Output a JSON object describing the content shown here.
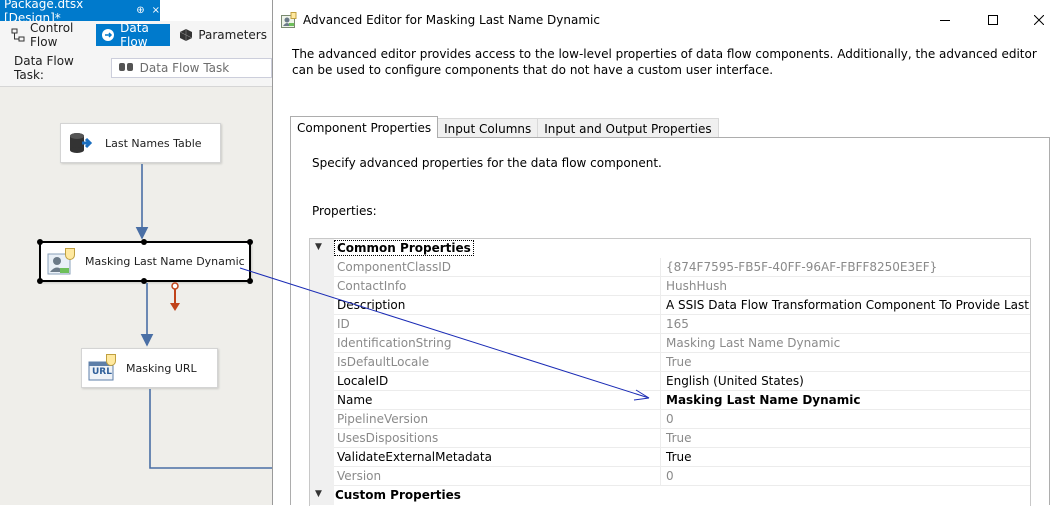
{
  "document_tab": {
    "title": "Package.dtsx [Design]*",
    "pin": "⊕",
    "close": "×"
  },
  "designer": {
    "tabs": [
      {
        "label": "Control Flow"
      },
      {
        "label": "Data Flow"
      },
      {
        "label": "Parameters"
      }
    ],
    "task_label": "Data Flow Task:",
    "task_value": "Data Flow Task",
    "nodes": {
      "source": "Last Names Table",
      "masking": "Masking Last Name Dynamic",
      "url": "Masking URL"
    },
    "url_icon_text": "URL"
  },
  "dialog": {
    "title": "Advanced Editor for Masking Last Name Dynamic",
    "description": "The advanced editor provides access to the low-level properties of data flow components. Additionally, the advanced editor can be used to configure components that do not have a custom user interface.",
    "tabs": [
      {
        "label": "Component Properties"
      },
      {
        "label": "Input Columns"
      },
      {
        "label": "Input and Output Properties"
      }
    ],
    "tab_description": "Specify advanced properties for the data flow component.",
    "properties_label": "Properties:",
    "categories": {
      "common": "Common Properties",
      "custom": "Custom Properties"
    },
    "rows": [
      {
        "name": "ComponentClassID",
        "value": "{874F7595-FB5F-40FF-96AF-FBFF8250E3EF}"
      },
      {
        "name": "ContactInfo",
        "value": "HushHush"
      },
      {
        "name": "Description",
        "value": "A SSIS Data Flow Transformation Component To Provide Last Name D"
      },
      {
        "name": "ID",
        "value": "165"
      },
      {
        "name": "IdentificationString",
        "value": "Masking Last Name Dynamic"
      },
      {
        "name": "IsDefaultLocale",
        "value": "True"
      },
      {
        "name": "LocaleID",
        "value": "English (United States)"
      },
      {
        "name": "Name",
        "value": "Masking Last Name Dynamic"
      },
      {
        "name": "PipelineVersion",
        "value": "0"
      },
      {
        "name": "UsesDispositions",
        "value": "True"
      },
      {
        "name": "ValidateExternalMetadata",
        "value": "True"
      },
      {
        "name": "Version",
        "value": "0"
      }
    ]
  },
  "colors": {
    "accent": "#007acc",
    "connector": "#4a6fa5",
    "error_path": "#c0431a",
    "annotation_arrow": "#1a2bb5"
  }
}
